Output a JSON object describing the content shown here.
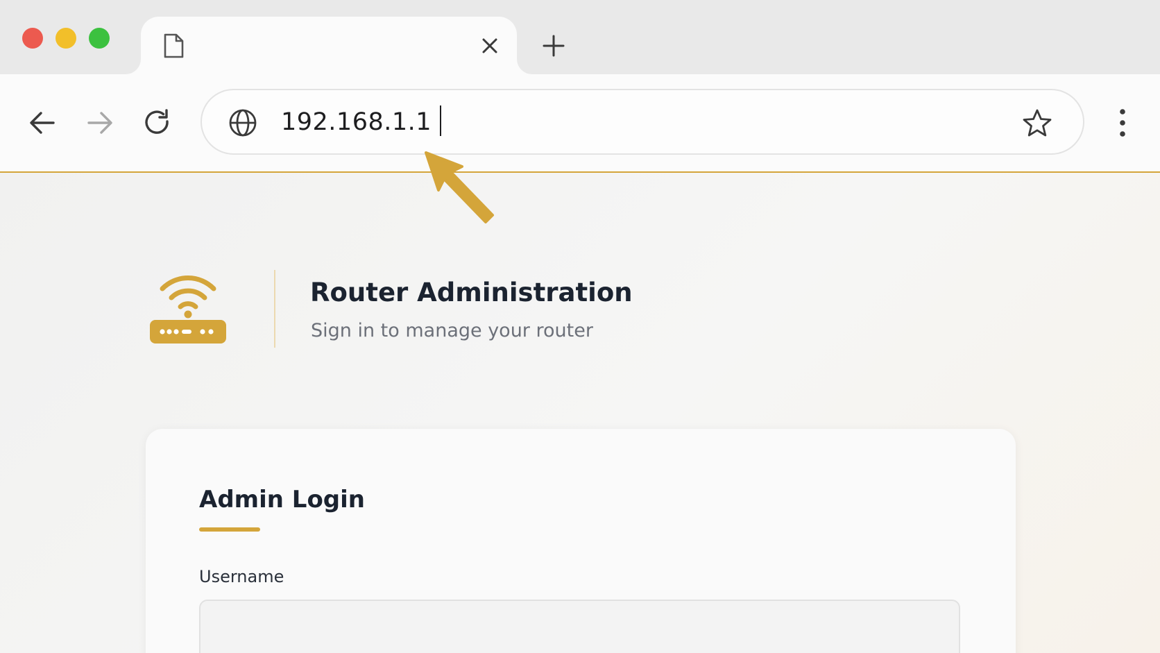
{
  "browser": {
    "window_controls": [
      "close",
      "minimize",
      "maximize"
    ],
    "tab": {
      "title": "",
      "icon": "page-icon",
      "close_icon": "close-icon"
    },
    "new_tab_icon": "plus-icon",
    "toolbar": {
      "back_icon": "arrow-left-icon",
      "forward_icon": "arrow-right-icon",
      "reload_icon": "reload-icon",
      "menu_icon": "kebab-menu-icon"
    },
    "address_bar": {
      "site_icon": "globe-icon",
      "url": "192.168.1.1",
      "bookmark_icon": "star-icon"
    },
    "accent_color": "#d4a53a"
  },
  "annotation": {
    "pointer_icon": "arrow-pointer-icon",
    "color": "#d4a53a"
  },
  "header": {
    "logo_icon": "router-wifi-icon",
    "title": "Router Administration",
    "subtitle": "Sign in to manage your router"
  },
  "login": {
    "title": "Admin Login",
    "username_label": "Username",
    "username_value": ""
  }
}
